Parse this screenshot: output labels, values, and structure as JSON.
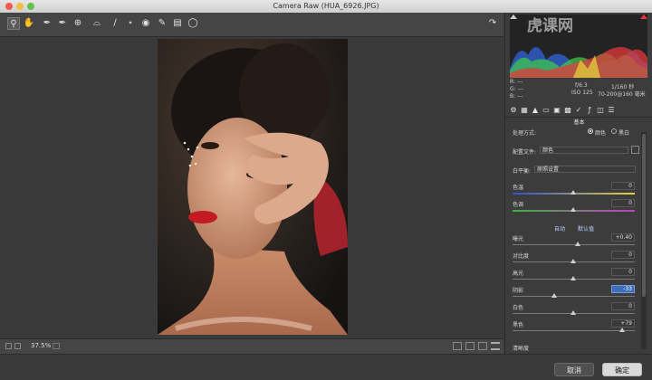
{
  "window": {
    "title": "Camera Raw (HUA_6926.JPG)"
  },
  "watermark": {
    "text": "虎课网"
  },
  "toolbar": {
    "tools": [
      "zoom-icon",
      "hand-icon",
      "white-balance-icon",
      "color-sampler-icon",
      "targeted-adjustment-icon",
      "crop-icon",
      "straighten-icon",
      "spot-removal-icon",
      "red-eye-icon",
      "adjustment-brush-icon",
      "graduated-filter-icon",
      "radial-filter-icon"
    ]
  },
  "info": {
    "r_label": "R:",
    "r_val": "---",
    "g_label": "G:",
    "g_val": "---",
    "b_label": "B:",
    "b_val": "---",
    "aperture": "f/6.3",
    "shutter": "1/160 秒",
    "iso": "ISO 125",
    "lens": "70-200@160 毫米"
  },
  "panel": {
    "section_title": "基本",
    "treatment_label": "处理方式:",
    "treatment_color": "颜色",
    "treatment_bw": "黑白",
    "profile_label": "配置文件:",
    "profile_value": "颜色",
    "wb_label": "白平衡:",
    "wb_value": "原照设置",
    "auto_label": "自动",
    "default_label": "默认值",
    "sliders": [
      {
        "label": "色温",
        "value": "0",
        "pos": 0.5
      },
      {
        "label": "色调",
        "value": "0",
        "pos": 0.5
      },
      {
        "label": "曝光",
        "value": "+0.40",
        "pos": 0.54
      },
      {
        "label": "对比度",
        "value": "0",
        "pos": 0.5
      },
      {
        "label": "高光",
        "value": "0",
        "pos": 0.5
      },
      {
        "label": "阴影",
        "value": "-33",
        "pos": 0.34
      },
      {
        "label": "白色",
        "value": "0",
        "pos": 0.5
      },
      {
        "label": "黑色",
        "value": "+79",
        "pos": 0.9
      },
      {
        "label": "清晰度",
        "value": "",
        "pos": 0.5
      }
    ]
  },
  "bottom": {
    "zoom": "37.5%"
  },
  "footer": {
    "cancel": "取消",
    "ok": "确定"
  },
  "colors": {
    "accent": "#3e6eb8",
    "panel": "#3c3c3c"
  }
}
